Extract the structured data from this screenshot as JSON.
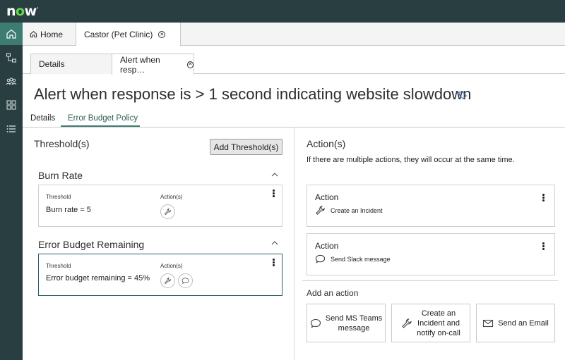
{
  "brand": {
    "logo": "now",
    "accent": "#3d7c72",
    "header_bg": "#293e40",
    "logo_dot": "#62d84e"
  },
  "rail": {
    "items": [
      "home-icon",
      "hierarchy-icon",
      "team-icon",
      "grid-icon",
      "list-icon"
    ]
  },
  "window_tabs": [
    {
      "label": "Home"
    },
    {
      "label": "Castor (Pet Clinic)"
    }
  ],
  "record_tabs": [
    {
      "label": "Details"
    },
    {
      "label": "Alert when resp…"
    }
  ],
  "page": {
    "title": "Alert when response is > 1 second indicating website slowdown"
  },
  "sub_tabs": [
    {
      "label": "Details"
    },
    {
      "label": "Error Budget Policy"
    }
  ],
  "thresholds": {
    "title": "Threshold(s)",
    "add_button": "Add Threshold(s)",
    "sections": [
      {
        "title": "Burn Rate",
        "threshold_label": "Threshold",
        "actions_label": "Action(s)",
        "value": "Burn rate = 5",
        "actions": [
          "wrench-icon"
        ]
      },
      {
        "title": "Error Budget Remaining",
        "threshold_label": "Threshold",
        "actions_label": "Action(s)",
        "value": "Error budget remaining = 45%",
        "actions": [
          "wrench-icon",
          "chat-icon"
        ]
      }
    ]
  },
  "actions": {
    "title": "Action(s)",
    "description": "If there are multiple actions, they will occur at the same time.",
    "items": [
      {
        "title": "Action",
        "label": "Create an Incident",
        "icon": "wrench-icon"
      },
      {
        "title": "Action",
        "label": "Send Slack message",
        "icon": "chat-icon"
      }
    ],
    "add_label": "Add an action",
    "options": [
      {
        "line1": "Send MS Teams",
        "line2": "message",
        "icon": "chat-icon"
      },
      {
        "line1": "Create an",
        "line2": "Incident and",
        "line3": "notify on-call",
        "icon": "wrench-icon"
      },
      {
        "line1": "Send an Email",
        "icon": "mail-icon"
      }
    ]
  }
}
